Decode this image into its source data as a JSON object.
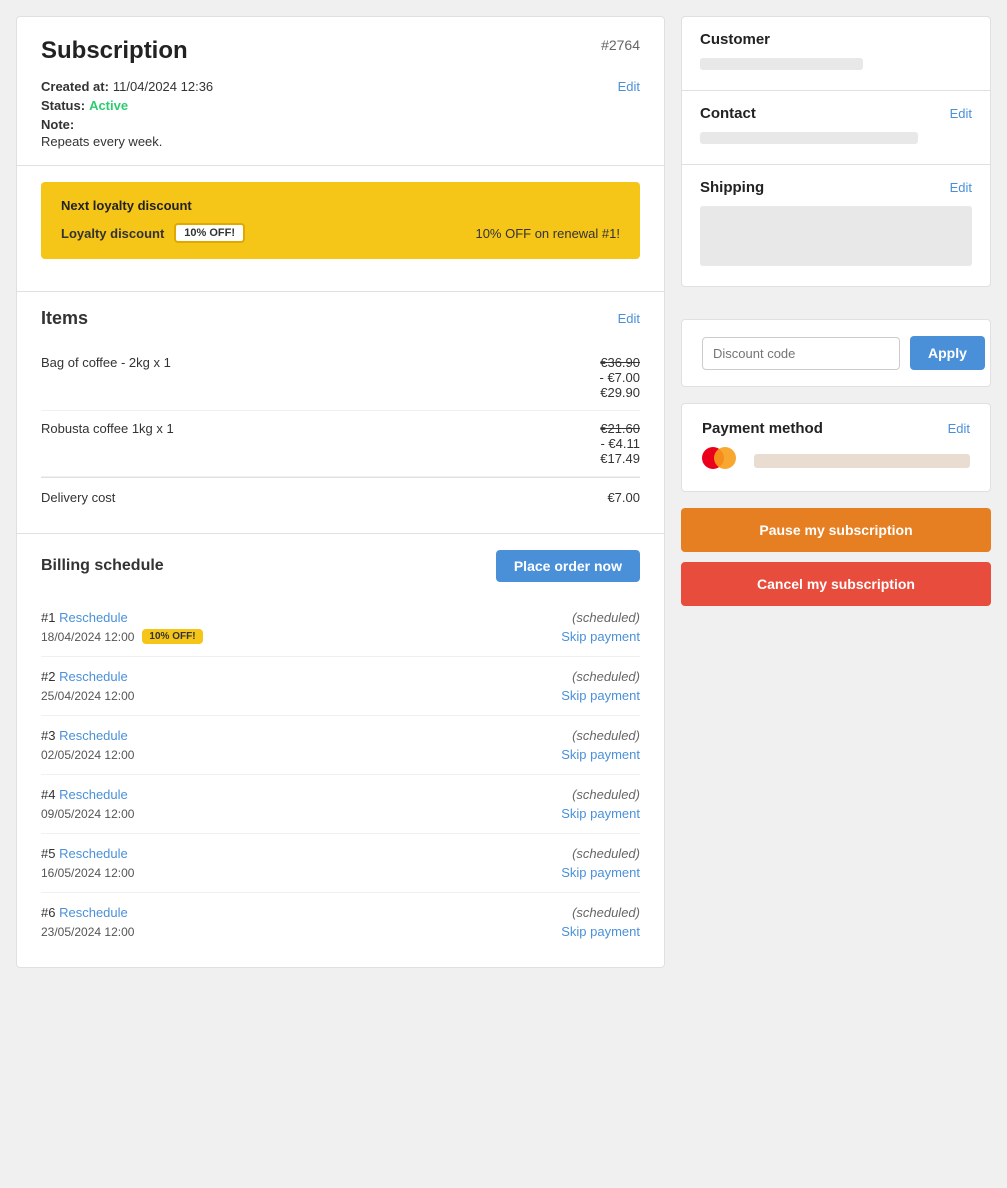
{
  "subscription": {
    "title": "Subscription",
    "id": "#2764",
    "created_label": "Created at:",
    "created_value": "11/04/2024 12:36",
    "status_label": "Status:",
    "status_value": "Active",
    "note_label": "Note:",
    "repeats": "Repeats every week.",
    "edit_label": "Edit"
  },
  "loyalty": {
    "next_label": "Next loyalty discount",
    "discount_label": "Loyalty discount",
    "badge": "10% OFF!",
    "description": "10% OFF on renewal #1!"
  },
  "items": {
    "title": "Items",
    "edit_label": "Edit",
    "list": [
      {
        "name": "Bag of coffee - 2kg x 1",
        "original": "€36.90",
        "discount": "- €7.00",
        "final": "€29.90"
      },
      {
        "name": "Robusta coffee 1kg x 1",
        "original": "€21.60",
        "discount": "- €4.11",
        "final": "€17.49"
      }
    ],
    "delivery_label": "Delivery cost",
    "delivery_value": "€7.00"
  },
  "billing": {
    "title": "Billing schedule",
    "place_order_label": "Place order now",
    "schedules": [
      {
        "num": "#1",
        "reschedule": "Reschedule",
        "status": "(scheduled)",
        "date": "18/04/2024 12:00",
        "badge": "10% OFF!",
        "skip": "Skip payment"
      },
      {
        "num": "#2",
        "reschedule": "Reschedule",
        "status": "(scheduled)",
        "date": "25/04/2024 12:00",
        "badge": null,
        "skip": "Skip payment"
      },
      {
        "num": "#3",
        "reschedule": "Reschedule",
        "status": "(scheduled)",
        "date": "02/05/2024 12:00",
        "badge": null,
        "skip": "Skip payment"
      },
      {
        "num": "#4",
        "reschedule": "Reschedule",
        "status": "(scheduled)",
        "date": "09/05/2024 12:00",
        "badge": null,
        "skip": "Skip payment"
      },
      {
        "num": "#5",
        "reschedule": "Reschedule",
        "status": "(scheduled)",
        "date": "16/05/2024 12:00",
        "badge": null,
        "skip": "Skip payment"
      },
      {
        "num": "#6",
        "reschedule": "Reschedule",
        "status": "(scheduled)",
        "date": "23/05/2024 12:00",
        "badge": null,
        "skip": "Skip payment"
      }
    ]
  },
  "sidebar": {
    "customer_title": "Customer",
    "contact_title": "Contact",
    "contact_edit": "Edit",
    "shipping_title": "Shipping",
    "shipping_edit": "Edit",
    "discount_placeholder": "Discount code",
    "apply_label": "Apply",
    "payment_title": "Payment method",
    "payment_edit": "Edit",
    "pause_label": "Pause my subscription",
    "cancel_label": "Cancel my subscription"
  }
}
